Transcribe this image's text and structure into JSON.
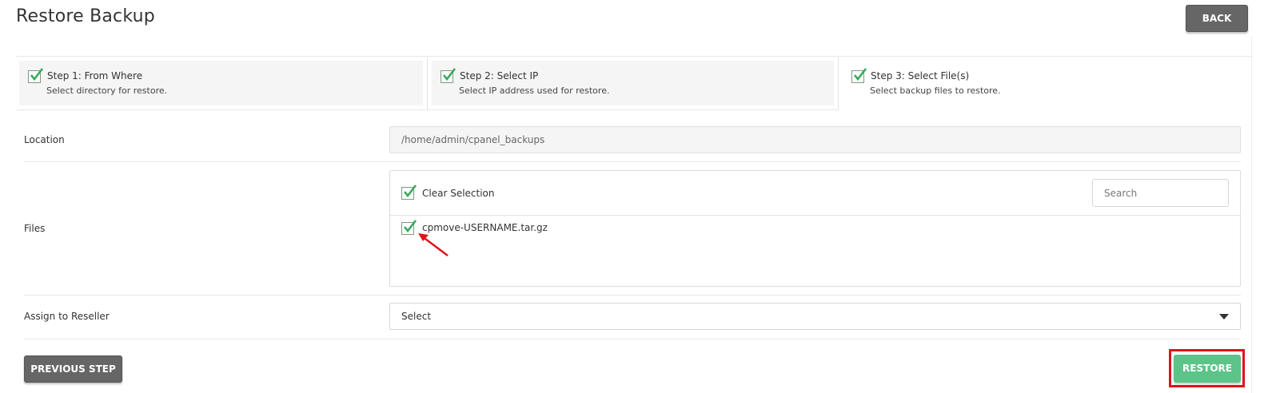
{
  "page": {
    "title": "Restore Backup",
    "back_label": "BACK"
  },
  "steps": [
    {
      "title": "Step 1: From Where",
      "description": "Select directory for restore.",
      "completed": true,
      "active": false
    },
    {
      "title": "Step 2: Select IP",
      "description": "Select IP address used for restore.",
      "completed": true,
      "active": false
    },
    {
      "title": "Step 3: Select File(s)",
      "description": "Select backup files to restore.",
      "completed": true,
      "active": true
    }
  ],
  "form": {
    "location": {
      "label": "Location",
      "value": "/home/admin/cpanel_backups"
    },
    "files": {
      "label": "Files",
      "clear_selection_label": "Clear Selection",
      "search_placeholder": "Search",
      "items": [
        {
          "name": "cpmove-USERNAME.tar.gz",
          "checked": true
        }
      ]
    },
    "reseller": {
      "label": "Assign to Reseller",
      "selected": "Select"
    }
  },
  "actions": {
    "previous_label": "PREVIOUS STEP",
    "restore_label": "RESTORE"
  },
  "colors": {
    "check_green": "#3aa85b",
    "button_gray": "#666666",
    "restore_green": "#5cc489",
    "highlight_red": "#e0131b",
    "annotation_red": "#e0131b"
  }
}
